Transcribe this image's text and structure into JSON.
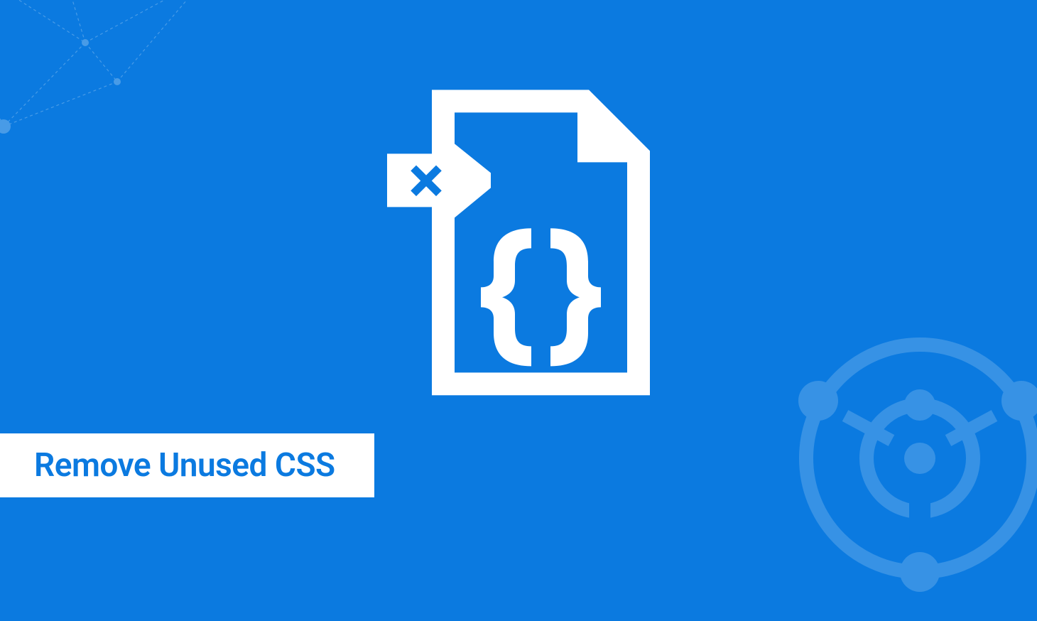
{
  "title": "Remove Unused CSS",
  "colors": {
    "background": "#0b7ae0",
    "foreground": "#ffffff",
    "accent": "#0b7ae0"
  },
  "icons": {
    "main": "css-file-delete",
    "tag": "close-x",
    "content": "curly-braces"
  }
}
